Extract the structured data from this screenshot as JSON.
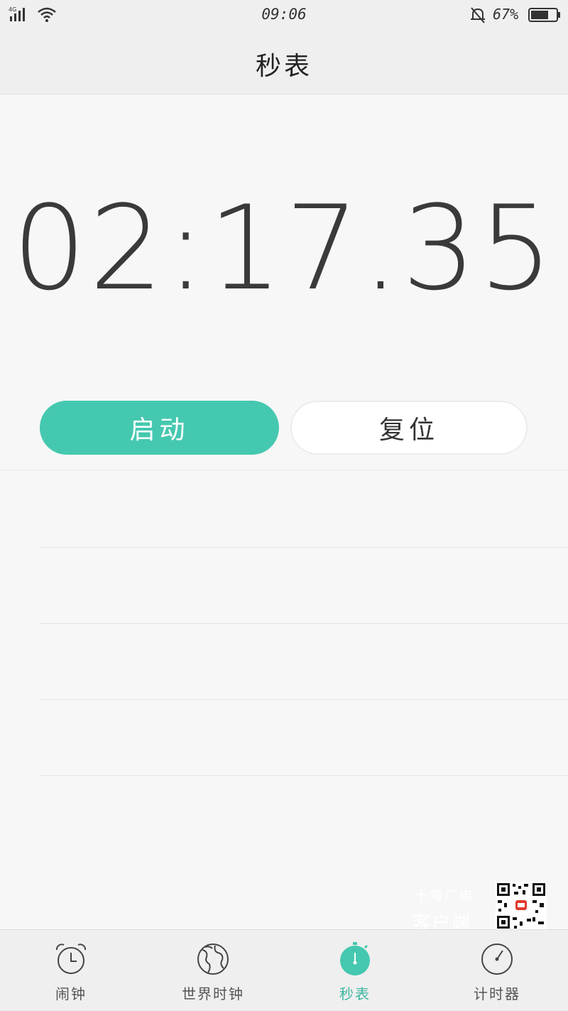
{
  "status_bar": {
    "network": "4G",
    "time": "09:06",
    "battery_percent": "67%",
    "icons": [
      "signal-icon",
      "wifi-icon",
      "silent-bell-icon",
      "battery-icon"
    ]
  },
  "header": {
    "title": "秒表"
  },
  "stopwatch": {
    "time": "02:17.35"
  },
  "buttons": {
    "start_label": "启动",
    "reset_label": "复位"
  },
  "watermark": {
    "line1": "十堰广电",
    "line2": "客户端"
  },
  "bottom_nav": {
    "items": [
      {
        "label": "闹钟",
        "icon": "alarm-clock-icon"
      },
      {
        "label": "世界时钟",
        "icon": "globe-icon"
      },
      {
        "label": "秒表",
        "icon": "stopwatch-icon",
        "active": true
      },
      {
        "label": "计时器",
        "icon": "timer-icon"
      }
    ]
  },
  "colors": {
    "accent": "#45c8b0",
    "active_label": "#3db79f"
  }
}
